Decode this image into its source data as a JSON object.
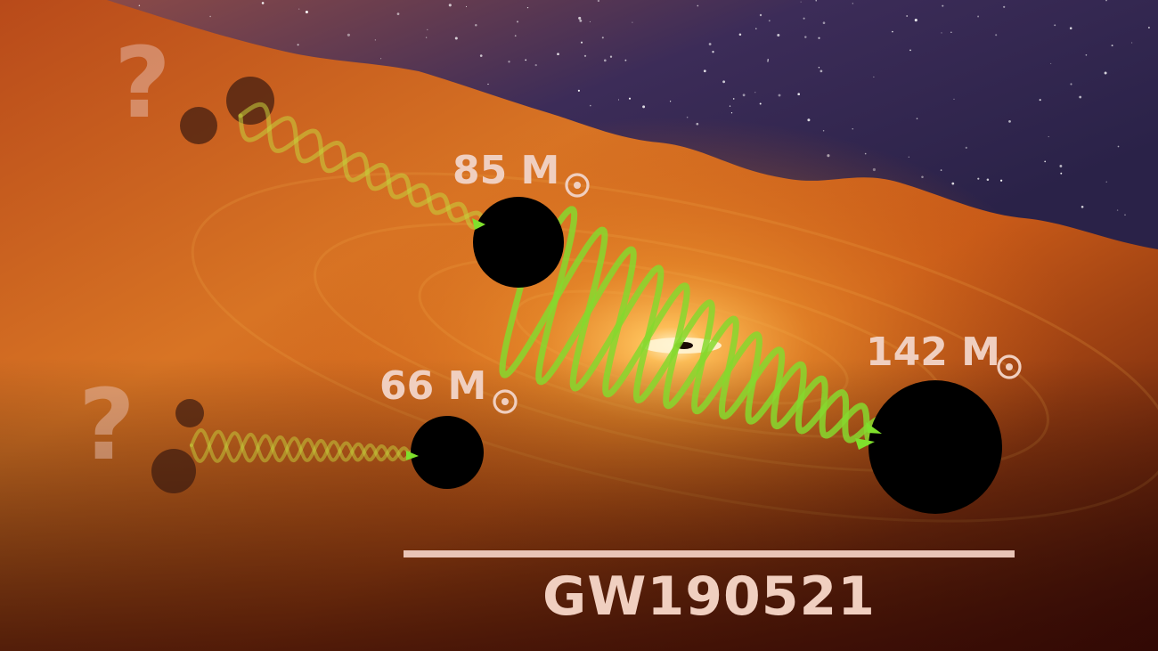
{
  "scene": {
    "event_name": "GW190521",
    "question_mark": "?",
    "masses": {
      "first_progenitor": {
        "value": "85 M",
        "symbol": "solar-mass-symbol"
      },
      "second_progenitor": {
        "value": "66 M",
        "symbol": "solar-mass-symbol"
      },
      "remnant": {
        "value": "142 M",
        "symbol": "solar-mass-symbol"
      }
    },
    "colors": {
      "sky_top": "#2e2450",
      "sky_mid": "#6b3a5a",
      "glow": "#f2a23a",
      "accretion_orange": "#d8661c",
      "deep_red": "#5c160c",
      "black_hole": "#000000",
      "wave_green": "#8fd62f",
      "label_pink": "#f0cfc0"
    }
  }
}
